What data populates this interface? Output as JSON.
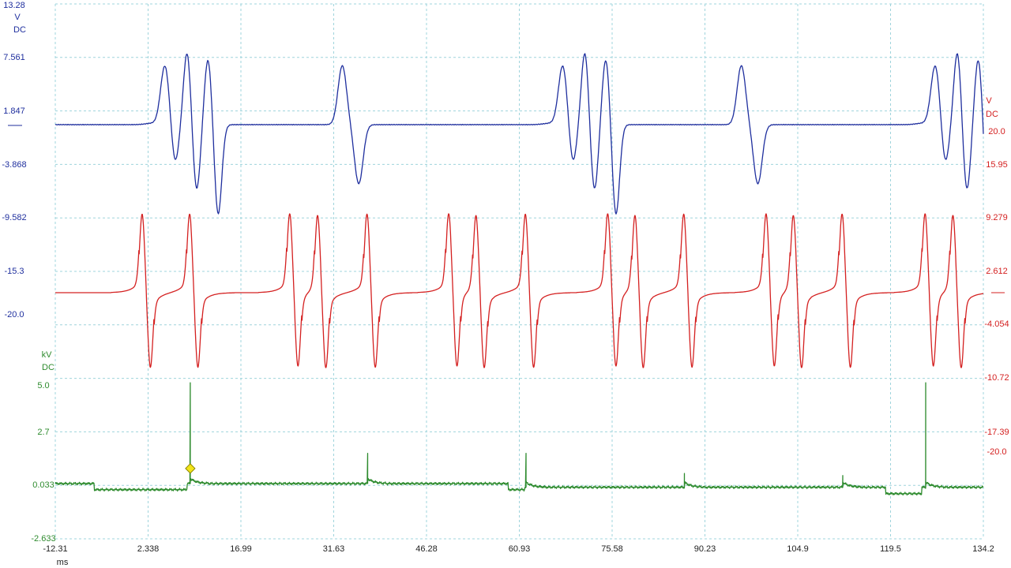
{
  "colors": {
    "blue": "#1f2f9e",
    "red": "#d42020",
    "green": "#2e8b2e",
    "grid": "#9fd4dc",
    "marker": "#f2e418"
  },
  "chart_data": {
    "type": "line",
    "x_axis": {
      "unit": "ms",
      "range": [
        -12.31,
        134.2
      ],
      "ticks": [
        "-12.31",
        "2.338",
        "16.99",
        "31.63",
        "46.28",
        "60.93",
        "75.58",
        "90.23",
        "104.9",
        "119.5",
        "134.2"
      ]
    },
    "axes": [
      {
        "id": "A",
        "color": "blue",
        "unit": "V",
        "coupling": "DC",
        "range": [
          -20.0,
          13.28
        ],
        "ticks": [
          "13.28",
          "7.561",
          "1.847",
          "-3.868",
          "-9.582",
          "-15.3",
          "-20.0"
        ]
      },
      {
        "id": "B",
        "color": "red",
        "unit": "V",
        "coupling": "DC",
        "range": [
          -20.0,
          20.0
        ],
        "ticks": [
          "20.0",
          "15.95",
          "9.279",
          "2.612",
          "-4.054",
          "-10.72",
          "-17.39",
          "-20.0"
        ]
      },
      {
        "id": "C",
        "color": "green",
        "unit": "kV",
        "coupling": "DC",
        "range": [
          -2.633,
          5.0
        ],
        "ticks": [
          "5.0",
          "2.7",
          "0.033",
          "-2.633"
        ]
      }
    ],
    "series": [
      {
        "axis": "A",
        "color": "blue",
        "baseline": 3.0,
        "events": [
          {
            "t": 7.2,
            "kind": "double"
          },
          {
            "t": 33.0,
            "kind": "single"
          },
          {
            "t": 70.0,
            "kind": "double"
          },
          {
            "t": 96.0,
            "kind": "single"
          },
          {
            "t": 128.8,
            "kind": "double"
          }
        ],
        "pulse": {
          "up": 8.5,
          "down": -8.0
        }
      },
      {
        "axis": "B",
        "color": "red",
        "baseline": 0.0,
        "spikes": [
          1.5,
          9.0,
          24.8,
          29.2,
          37.0,
          49.9,
          54.2,
          62.0,
          75.0,
          79.3,
          87.0,
          100.0,
          104.3,
          112.0,
          125.1,
          129.5
        ],
        "pulse": {
          "up": 10.3,
          "down": -10.3
        }
      },
      {
        "axis": "C",
        "color": "green",
        "baseline": 0.033,
        "spikes": [
          {
            "t": 9.0,
            "peak": 5.0
          },
          {
            "t": 37.0,
            "peak": 1.5
          },
          {
            "t": 62.0,
            "peak": 1.5
          },
          {
            "t": 87.0,
            "peak": 0.5
          },
          {
            "t": 112.0,
            "peak": 0.4
          },
          {
            "t": 125.1,
            "peak": 5.0
          }
        ],
        "steps": [
          {
            "from": -6.2,
            "to": 8.5,
            "offset": -0.3
          },
          {
            "from": 59.2,
            "to": 61.8,
            "offset": -0.3
          },
          {
            "from": 61.8,
            "to": 134.2,
            "offset": -0.18
          },
          {
            "from": 118.8,
            "to": 124.5,
            "offset": -0.5
          }
        ],
        "trigger": {
          "t": 9.0,
          "v": 0.75
        }
      }
    ],
    "grid": true
  }
}
